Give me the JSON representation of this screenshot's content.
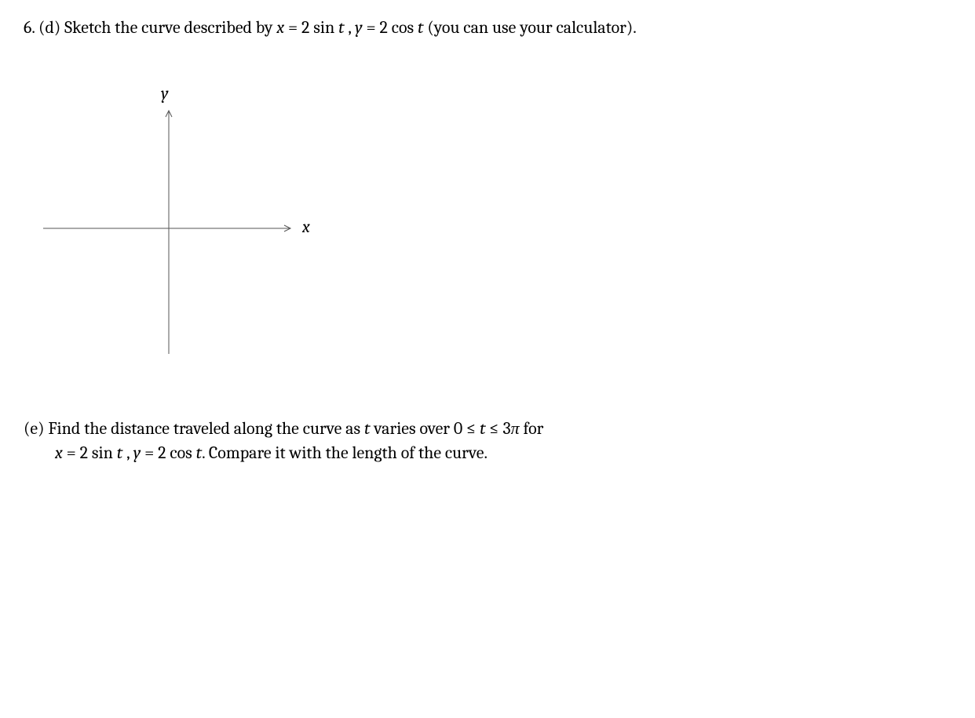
{
  "partD": {
    "number": "6. (d)",
    "text1": "  Sketch the curve described by ",
    "eq1_x": "x",
    "eq1_eq": " = 2 sin ",
    "eq1_t": "t",
    "eq1_comma": " , ",
    "eq1_y": "y",
    "eq1_eq2": " = 2 cos ",
    "eq1_t2": "t",
    "text2": " (you can use your calculator)."
  },
  "axes": {
    "yLabel": "y",
    "xLabel": "x"
  },
  "partE": {
    "label": "(e) ",
    "text1": "Find the distance traveled along the curve as ",
    "t1": "t",
    "text2": " varies over 0 ≤ ",
    "t2": "t",
    "text3": " ≤ 3",
    "pi": "π",
    "text4": " for",
    "line2_x": "x",
    "line2_eq1": " = 2 sin ",
    "line2_t1": "t",
    "line2_comma": " , ",
    "line2_y": "y",
    "line2_eq2": " = 2 cos ",
    "line2_t2": "t",
    "line2_text": ". Compare it with the length of the curve."
  }
}
